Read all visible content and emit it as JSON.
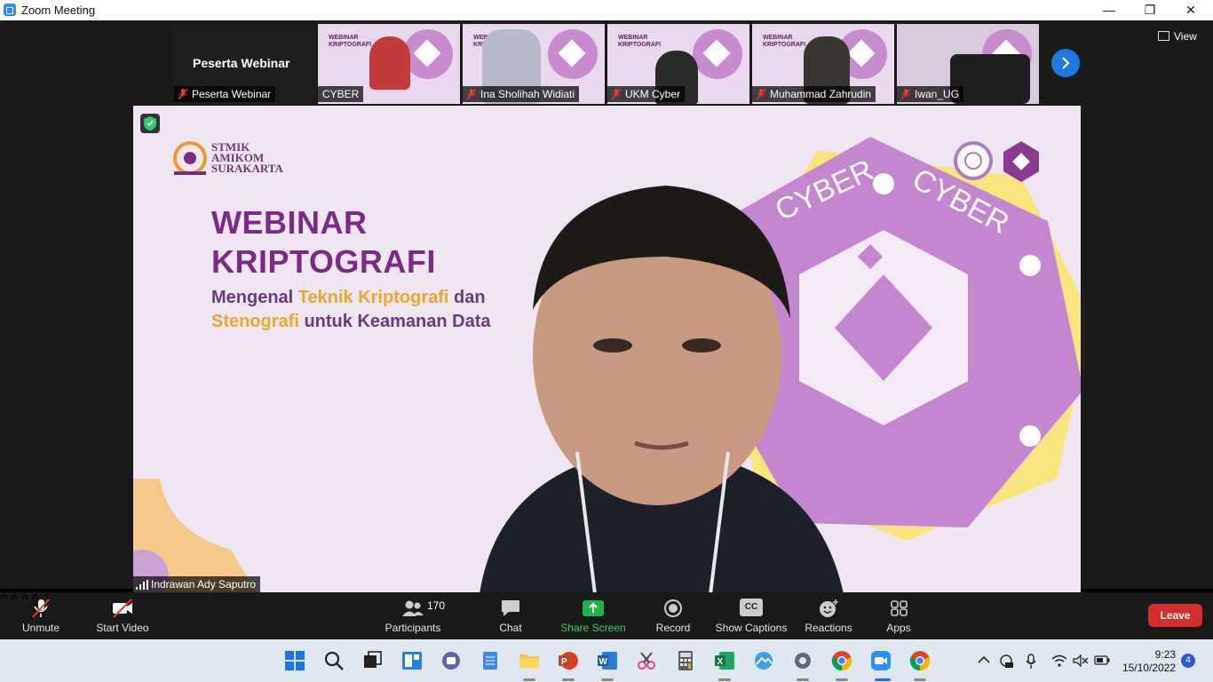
{
  "window": {
    "title": "Zoom Meeting",
    "controls": {
      "minimize": "—",
      "restore": "❐",
      "close": "✕"
    }
  },
  "gallery": {
    "self_tile_name": "Peserta Webinar",
    "self_tile_tag": "Peserta Webinar",
    "participants": [
      {
        "name": "CYBER",
        "muted": true
      },
      {
        "name": "Ina Sholihah Widiati",
        "muted": true
      },
      {
        "name": "UKM Cyber",
        "muted": true
      },
      {
        "name": "Muhammad Zahrudin",
        "muted": true
      },
      {
        "name": "Iwan_UG",
        "muted": true
      }
    ],
    "thumb_slide_title": "WEBINAR\nKRIPTOGRAFI",
    "next_icon": "chevron-right-icon",
    "view_label": "View"
  },
  "main": {
    "speaker_name": "Indrawan Ady Saputro",
    "slide": {
      "org_line1": "STMIK",
      "org_line2": "AMIKOM",
      "org_line3": "SURAKARTA",
      "title_line1": "WEBINAR",
      "title_line2": "KRIPTOGRAFI",
      "sub_a": "Mengenal ",
      "sub_b": "Teknik Kriptografi",
      "sub_c": " dan",
      "sub_d": "Stenografi",
      "sub_e": " untuk Keamanan Data",
      "badge_text": "CYBER"
    }
  },
  "toolbar": {
    "unmute": "Unmute",
    "start_video": "Start Video",
    "participants": "Participants",
    "participants_count": "170",
    "chat": "Chat",
    "share_screen": "Share Screen",
    "record": "Record",
    "show_captions": "Show Captions",
    "captions_icon_text": "CC",
    "reactions": "Reactions",
    "apps": "Apps",
    "leave": "Leave",
    "caret": "^"
  },
  "taskbar": {
    "time": "9:23",
    "date": "15/10/2022",
    "notifications": "4",
    "app_icons": [
      "windows-start-icon",
      "search-icon",
      "task-view-icon",
      "widgets-icon",
      "teams-chat-icon",
      "notepad-icon",
      "file-explorer-icon",
      "powerpoint-icon",
      "word-icon",
      "snipping-tool-icon",
      "calculator-icon",
      "excel-icon",
      "photos-icon",
      "settings-icon",
      "chrome-icon",
      "zoom-icon",
      "chrome-icon"
    ]
  },
  "colors": {
    "accent_blue": "#2d8cff",
    "share_green": "#3fd25b",
    "leave_red": "#d32f2f",
    "slide_purple": "#7b2a86",
    "slide_orange": "#e8a82a"
  }
}
